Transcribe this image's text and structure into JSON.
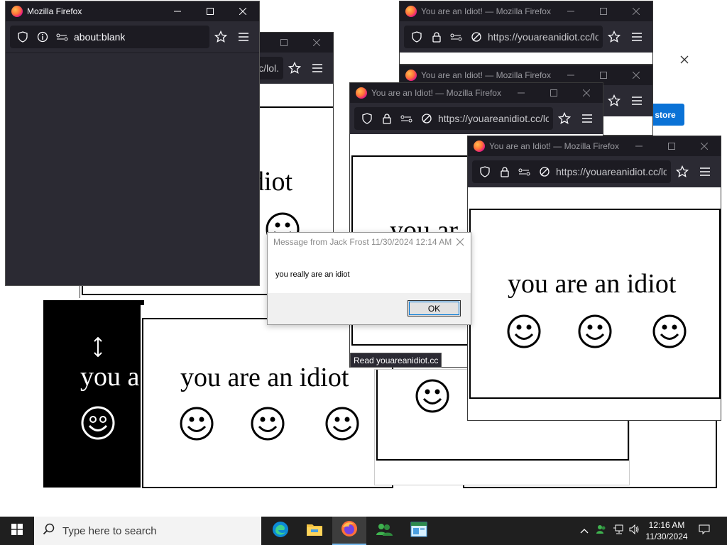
{
  "colors": {
    "titlebar": "#1c1b22",
    "toolbar": "#2b2a33",
    "taskbar": "#1f1f1f",
    "accent": "#0078d7"
  },
  "windows": {
    "front_firefox": {
      "title": "Mozilla Firefox",
      "url": "about:blank"
    },
    "idiot_title": "You are an Idiot! — Mozilla Firefox",
    "idiot_url": "https://youareanidiot.cc/lol.",
    "idiot_url_short": "c/lol.",
    "idiot_text": "you are an idiot",
    "idiot_text_a": "you a",
    "idiot_text_iot": "diot",
    "idiot_text_yar": "you ar",
    "store_button": "store"
  },
  "dialog": {
    "title": "Message from Jack Frost 11/30/2024 12:14 AM",
    "message": "you really are an idiot",
    "ok_label": "OK"
  },
  "tooltip": {
    "text": "Read youareanidiot.cc"
  },
  "taskbar": {
    "search_placeholder": "Type here to search",
    "apps": [
      "edge-icon",
      "file-explorer-icon",
      "firefox-icon",
      "people-icon",
      "app-icon"
    ],
    "time": "12:16 AM",
    "date": "11/30/2024"
  }
}
